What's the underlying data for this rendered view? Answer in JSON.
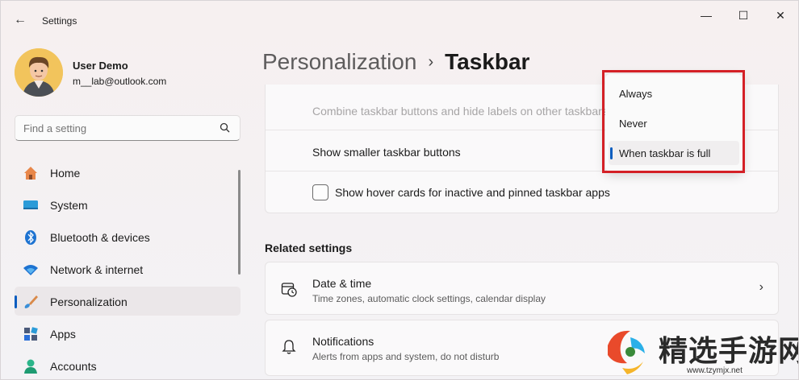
{
  "window": {
    "title": "Settings",
    "back": "←",
    "controls": {
      "minimize": "—",
      "maximize": "☐",
      "close": "✕"
    }
  },
  "user": {
    "name": "User Demo",
    "email": "m__lab@outlook.com"
  },
  "search": {
    "placeholder": "Find a setting",
    "value": ""
  },
  "sidebar": {
    "items": [
      {
        "label": "Home",
        "icon": "home-icon"
      },
      {
        "label": "System",
        "icon": "system-icon"
      },
      {
        "label": "Bluetooth & devices",
        "icon": "bluetooth-icon"
      },
      {
        "label": "Network & internet",
        "icon": "wifi-icon"
      },
      {
        "label": "Personalization",
        "icon": "brush-icon",
        "selected": true
      },
      {
        "label": "Apps",
        "icon": "apps-icon"
      },
      {
        "label": "Accounts",
        "icon": "accounts-icon"
      }
    ]
  },
  "breadcrumb": {
    "parent": "Personalization",
    "separator": "›",
    "current": "Taskbar"
  },
  "taskbar_card": {
    "combine_other": "Combine taskbar buttons and hide labels on other taskbars",
    "smaller_buttons": "Show smaller taskbar buttons",
    "hover_cards": "Show hover cards for inactive and pinned taskbar apps",
    "hover_cards_checked": false
  },
  "dropdown": {
    "options": [
      "Always",
      "Never",
      "When taskbar is full"
    ],
    "selected": "When taskbar is full"
  },
  "related": {
    "title": "Related settings",
    "items": [
      {
        "title": "Date & time",
        "desc": "Time zones, automatic clock settings, calendar display",
        "icon": "clock-calendar-icon"
      },
      {
        "title": "Notifications",
        "desc": "Alerts from apps and system, do not disturb",
        "icon": "bell-icon"
      }
    ]
  },
  "watermark": {
    "text": "精选手游网",
    "url": "www.tzymjx.net"
  },
  "colors": {
    "accent": "#0a5dbf",
    "highlight": "#d42026"
  }
}
